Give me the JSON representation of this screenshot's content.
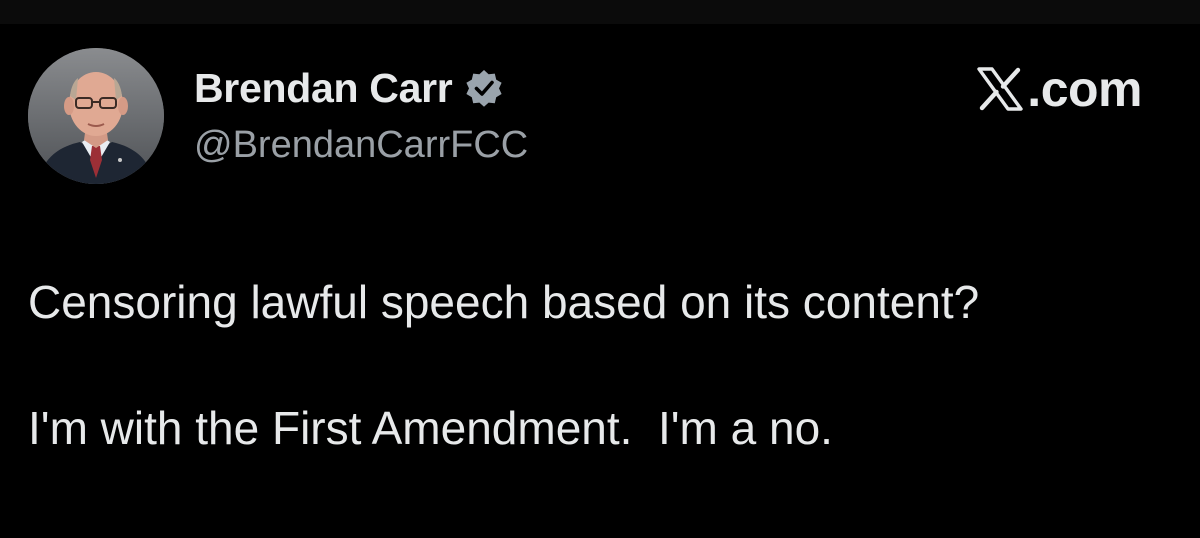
{
  "post": {
    "author": {
      "display_name": "Brendan Carr",
      "handle": "@BrendanCarrFCC",
      "verified_icon": "verified-badge-icon",
      "avatar": "profile-photo"
    },
    "site": {
      "label": ".com",
      "logo_icon": "x-logo-icon"
    },
    "text_lines": [
      "Censoring lawful speech based on its content?",
      "I'm with the First Amendment.  I'm a no."
    ]
  },
  "colors": {
    "background": "#000000",
    "text_primary": "#e7e9ea",
    "text_secondary": "#9aa0a6",
    "verified_badge": "#9aa4ad"
  }
}
